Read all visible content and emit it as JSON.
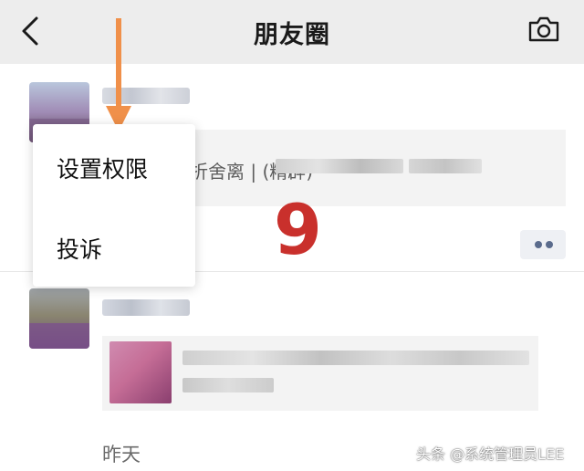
{
  "header": {
    "title": "朋友圈",
    "back_icon": "chevron-left-icon",
    "camera_icon": "camera-icon",
    "background": "#ededed"
  },
  "popup_menu": {
    "items": [
      {
        "label": "设置权限"
      },
      {
        "label": "投诉"
      }
    ]
  },
  "annotation": {
    "step_number": "9",
    "number_color": "#c9302c",
    "arrow_color": "#f0904a"
  },
  "post1": {
    "link_text_visible": "折舍离   |               (精辟)"
  },
  "post2": {
    "timestamp": "昨天"
  },
  "more_button": {
    "icon": "more-dots-icon"
  },
  "watermark": "头条 @系统管理员LEE"
}
